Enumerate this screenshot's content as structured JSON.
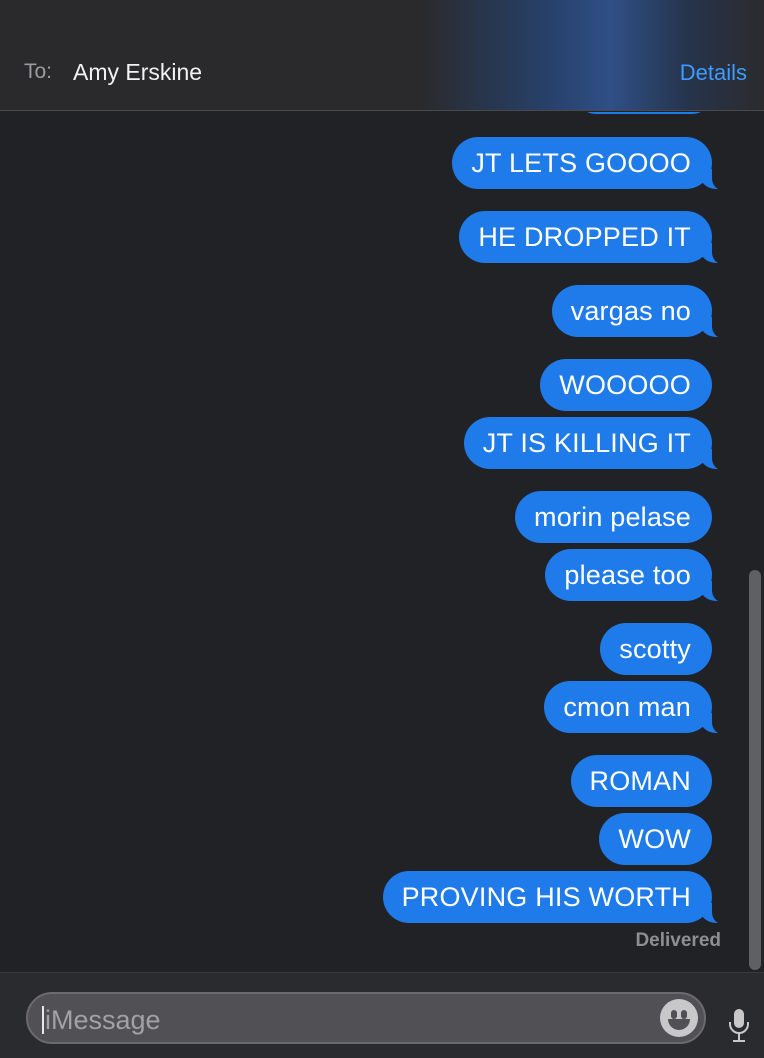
{
  "header": {
    "to_label": "To:",
    "recipient": "Amy Erskine",
    "details_label": "Details"
  },
  "messages": [
    {
      "text": "JT LETS GOOOO"
    },
    {
      "text": "HE DROPPED IT"
    },
    {
      "text": "vargas no"
    },
    {
      "text": "WOOOOO"
    },
    {
      "text": "JT IS KILLING IT"
    },
    {
      "text": "morin pelase"
    },
    {
      "text": "please too"
    },
    {
      "text": "scotty"
    },
    {
      "text": "cmon man"
    },
    {
      "text": "ROMAN"
    },
    {
      "text": "WOW"
    },
    {
      "text": "PROVING HIS WORTH"
    }
  ],
  "status": "Delivered",
  "composer": {
    "placeholder": "iMessage",
    "emoji_icon": "smiley-icon",
    "mic_icon": "microphone-icon"
  },
  "colors": {
    "bubble": "#1f7aea",
    "background": "#202225",
    "accent": "#3f9bff"
  }
}
